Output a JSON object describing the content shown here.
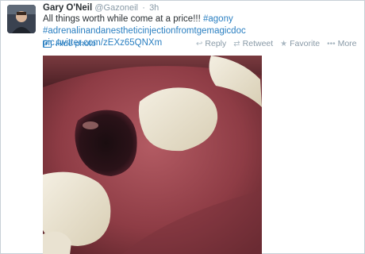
{
  "tweet": {
    "author_name": "Gary O'Neil",
    "author_handle": "@Gazoneil",
    "separator": "·",
    "timestamp": "3h",
    "text_line1": "All things worth while come at a price!!!",
    "hashtag1": "#agony",
    "hashtag2": "#adrenalinandanestheticinjectionfromtgemagicdoc",
    "pic_link": "pic.twitter.com/zEXz65QNXm"
  },
  "media": {
    "hide_photo_label": "Hide photo",
    "hide_photo_icon": "photo-icon"
  },
  "actions": {
    "reply_icon": "reply-icon",
    "reply_label": "Reply",
    "retweet_icon": "retweet-icon",
    "retweet_label": "Retweet",
    "favorite_icon": "star-icon",
    "favorite_label": "Favorite",
    "more_icon": "more-icon",
    "more_label": "More"
  },
  "colors": {
    "link": "#2a7fc1",
    "muted": "#8899a6",
    "name": "#292f33"
  }
}
